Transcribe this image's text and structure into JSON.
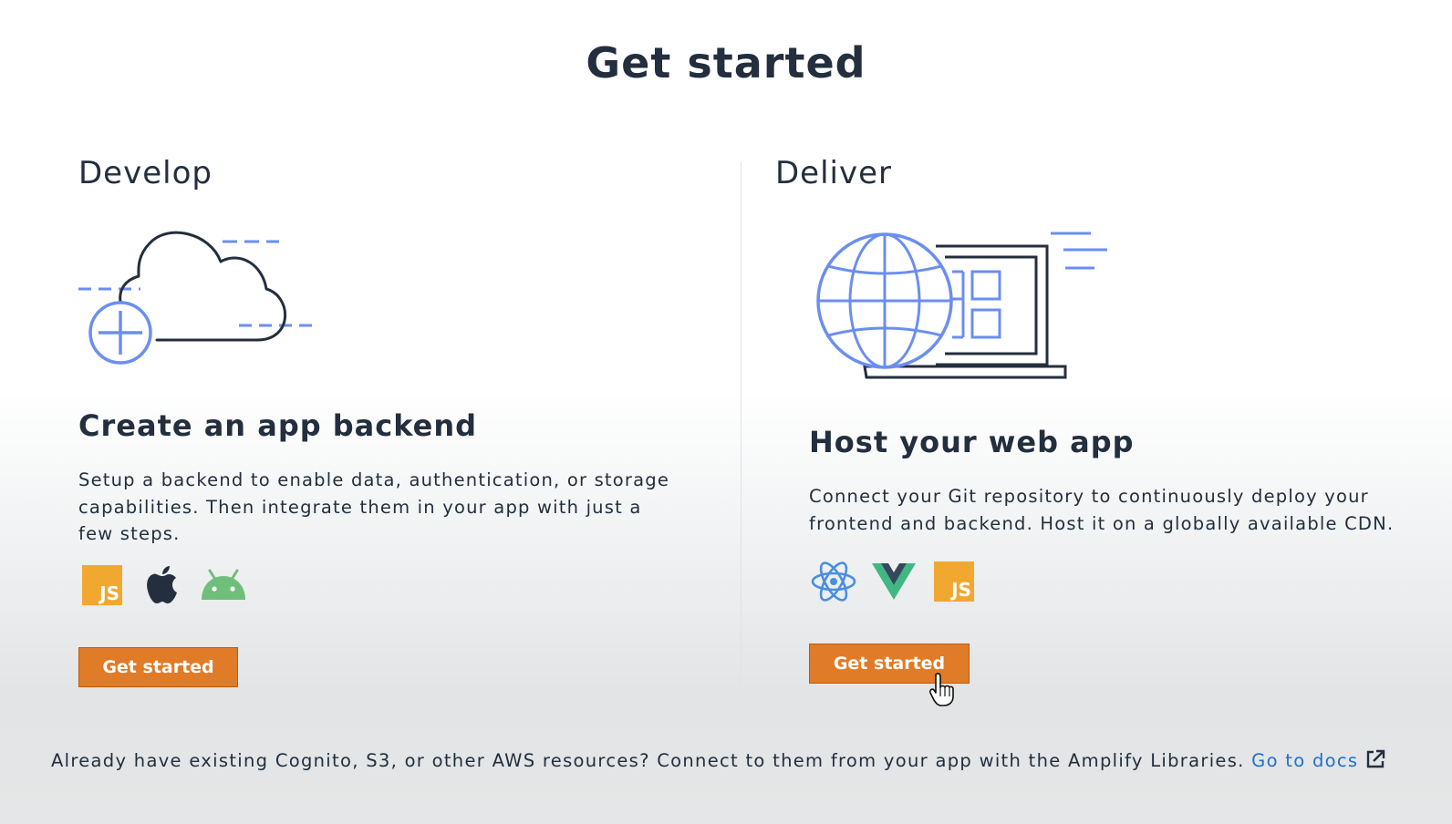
{
  "page": {
    "title": "Get started"
  },
  "develop": {
    "heading": "Develop",
    "card_title": "Create an app backend",
    "description": "Setup a backend to enable data, authentication, or storage capabilities. Then integrate them in your app with just a few steps.",
    "platform_icons": [
      "javascript-icon",
      "apple-icon",
      "android-icon"
    ],
    "js_badge_text": "JS",
    "button_label": "Get started"
  },
  "deliver": {
    "heading": "Deliver",
    "card_title": "Host your web app",
    "description": "Connect your Git repository to continuously deploy your frontend and backend. Host it on a globally available CDN.",
    "framework_icons": [
      "react-icon",
      "vue-icon",
      "javascript-icon"
    ],
    "js_badge_text": "JS",
    "button_label": "Get started"
  },
  "footer": {
    "text": "Already have existing Cognito, S3, or other AWS resources? Connect to them from your app with the Amplify Libraries.",
    "link_label": "Go to docs"
  },
  "colors": {
    "accent_orange": "#e07b28",
    "illustration_blue": "#6b8ef0",
    "link_blue": "#2070c8",
    "text_dark": "#232f3e",
    "js_yellow": "#f0a830",
    "android_green": "#6fbf7a",
    "vue_green": "#41b883",
    "react_blue": "#4a8fe0"
  }
}
